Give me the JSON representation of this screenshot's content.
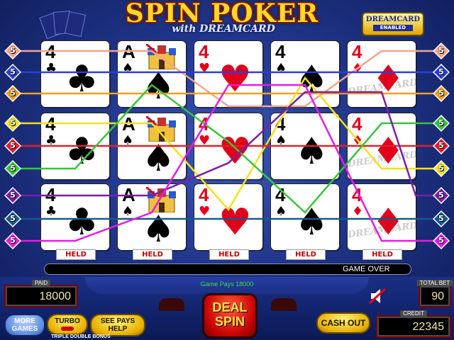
{
  "title": {
    "main": "SPIN POKER",
    "sub": "with DREAMCARD",
    "badge_line1": "DREAMCARD",
    "badge_line2": "ENABLED"
  },
  "rows": [
    {
      "cards": [
        {
          "rank": "4",
          "suit": "♣",
          "color": "black"
        },
        {
          "rank": "A",
          "suit": "♠",
          "color": "black",
          "castle": true
        },
        {
          "rank": "4",
          "suit": "♥",
          "color": "red"
        },
        {
          "rank": "4",
          "suit": "♠",
          "color": "black"
        },
        {
          "rank": "4",
          "suit": "♦",
          "color": "red",
          "dream": true
        }
      ]
    },
    {
      "cards": [
        {
          "rank": "4",
          "suit": "♣",
          "color": "black"
        },
        {
          "rank": "A",
          "suit": "♠",
          "color": "black",
          "castle": true
        },
        {
          "rank": "4",
          "suit": "♥",
          "color": "red"
        },
        {
          "rank": "4",
          "suit": "♠",
          "color": "black"
        },
        {
          "rank": "4",
          "suit": "♦",
          "color": "red",
          "dream": true
        }
      ]
    },
    {
      "cards": [
        {
          "rank": "4",
          "suit": "♣",
          "color": "black"
        },
        {
          "rank": "A",
          "suit": "♠",
          "color": "black",
          "castle": true
        },
        {
          "rank": "4",
          "suit": "♥",
          "color": "red"
        },
        {
          "rank": "4",
          "suit": "♠",
          "color": "black"
        },
        {
          "rank": "4",
          "suit": "♦",
          "color": "red",
          "dream": true
        }
      ]
    }
  ],
  "dream_text": "DREAMCARD",
  "held_label": "HELD",
  "line_markers": {
    "left": [
      {
        "num": "5",
        "color": "#f3a48b"
      },
      {
        "num": "5",
        "color": "#2b3fd6"
      },
      {
        "num": "5",
        "color": "#f0a020"
      },
      {
        "num": "5",
        "color": "#f2e21c"
      },
      {
        "num": "5",
        "color": "#e0222a"
      },
      {
        "num": "5",
        "color": "#39c43a"
      },
      {
        "num": "5",
        "color": "#7a1fa8"
      },
      {
        "num": "5",
        "color": "#155a8a"
      },
      {
        "num": "5",
        "color": "#e21ee0"
      }
    ],
    "right": [
      {
        "num": "5",
        "color": "#f3a48b"
      },
      {
        "num": "5",
        "color": "#2b3fd6"
      },
      {
        "num": "5",
        "color": "#f0a020"
      },
      {
        "num": "5",
        "color": "#39c43a"
      },
      {
        "num": "5",
        "color": "#e0222a"
      },
      {
        "num": "5",
        "color": "#f2e21c"
      },
      {
        "num": "5",
        "color": "#7a1fa8"
      },
      {
        "num": "5",
        "color": "#155a8a"
      },
      {
        "num": "5",
        "color": "#e21ee0"
      }
    ]
  },
  "status": {
    "game_over": "GAME OVER",
    "game_pays": "Game Pays 18000"
  },
  "paid": {
    "label": "PAID",
    "value": "18000"
  },
  "total_bet": {
    "label": "TOTAL BET",
    "value": "90"
  },
  "credit": {
    "label": "CREDIT",
    "value": "22345"
  },
  "buttons": {
    "more_games": "MORE GAMES",
    "turbo": "TURBO",
    "see_pays": "SEE PAYS HELP",
    "deal_spin_1": "DEAL",
    "deal_spin_2": "SPIN",
    "cash_out": "CASH OUT"
  },
  "game_variant": "TRIPLE DOUBLE BONUS"
}
